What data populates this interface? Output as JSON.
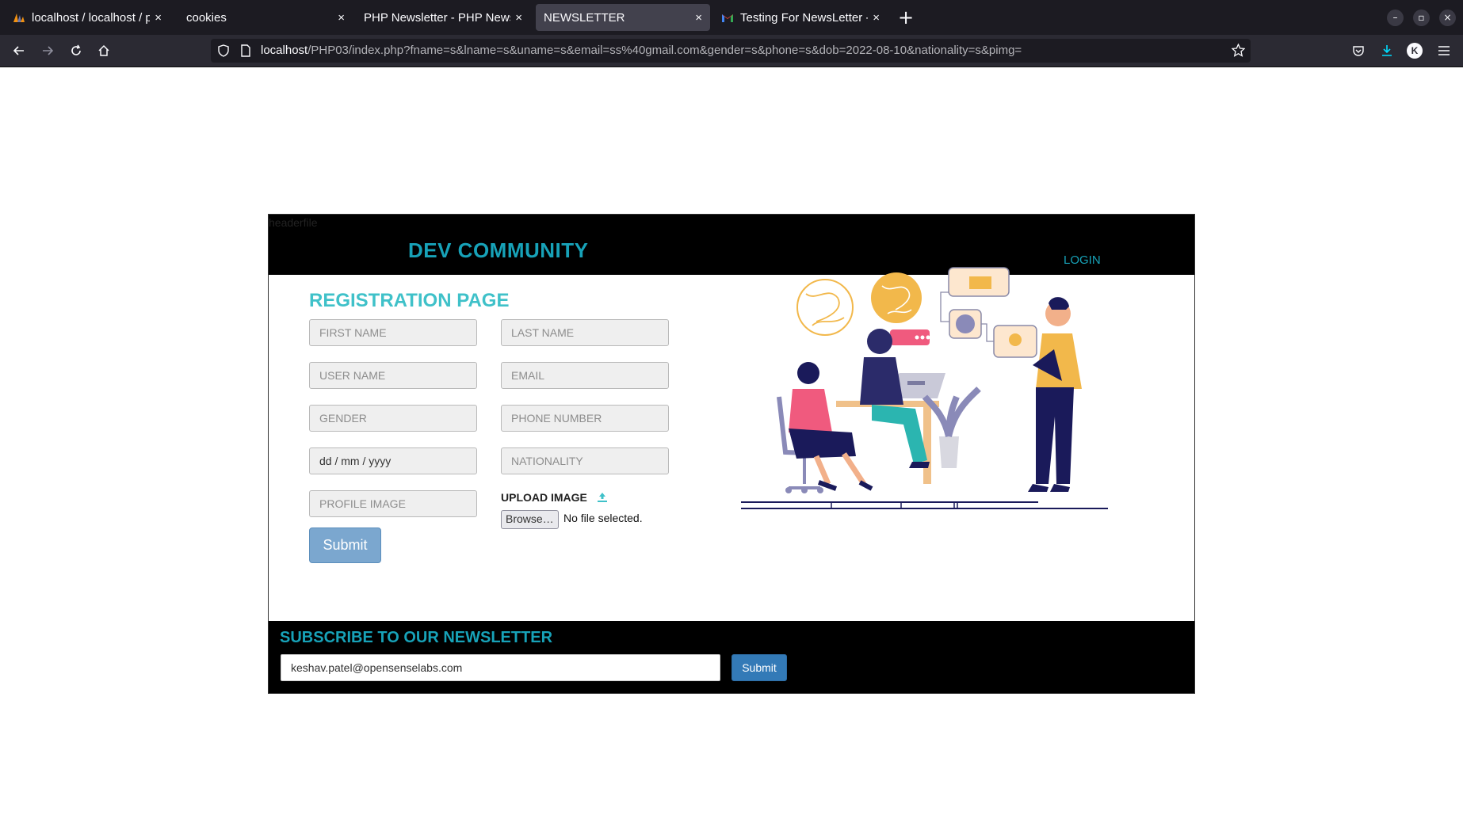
{
  "browser": {
    "tabs": [
      {
        "title": "localhost / localhost / php",
        "close": "×",
        "favicon": "phpmyadmin-icon"
      },
      {
        "title": "cookies",
        "close": "×"
      },
      {
        "title": "PHP Newsletter - PHP Newsl",
        "close": "×"
      },
      {
        "title": "NEWSLETTER",
        "close": "×",
        "active": true
      },
      {
        "title": "Testing For NewsLetter -",
        "close": "×",
        "favicon": "gmail-icon"
      }
    ],
    "new_tab": "+",
    "window_controls": {
      "minimize": "–",
      "restore": "▫",
      "close": "×"
    },
    "url_host": "localhost",
    "url_path": "/PHP03/index.php?fname=s&lname=s&uname=s&email=ss%40gmail.com&gender=s&phone=s&dob=2022-08-10&nationality=s&pimg=",
    "account_initial": "K"
  },
  "header": {
    "headerfile": "headerfile",
    "brand": "DEV COMMUNITY",
    "login": "LOGIN"
  },
  "form": {
    "title": "REGISTRATION PAGE",
    "first_name": "FIRST NAME",
    "last_name": "LAST NAME",
    "user_name": "USER NAME",
    "email": "EMAIL",
    "gender": "GENDER",
    "phone": "PHONE NUMBER",
    "dob": "dd / mm / yyyy",
    "nationality": "NATIONALITY",
    "profile_image": "PROFILE IMAGE",
    "upload_label": "UPLOAD IMAGE",
    "browse": "Browse…",
    "no_file": "No file selected.",
    "submit": "Submit"
  },
  "newsletter": {
    "title": "SUBSCRIBE TO OUR NEWSLETTER",
    "email_value": "keshav.patel@opensenselabs.com",
    "submit": "Submit"
  },
  "colors": {
    "accent": "#17a2b8",
    "title": "#3fc1c9",
    "submit_main": "#7ba7cf",
    "submit_news": "#337ab7"
  }
}
